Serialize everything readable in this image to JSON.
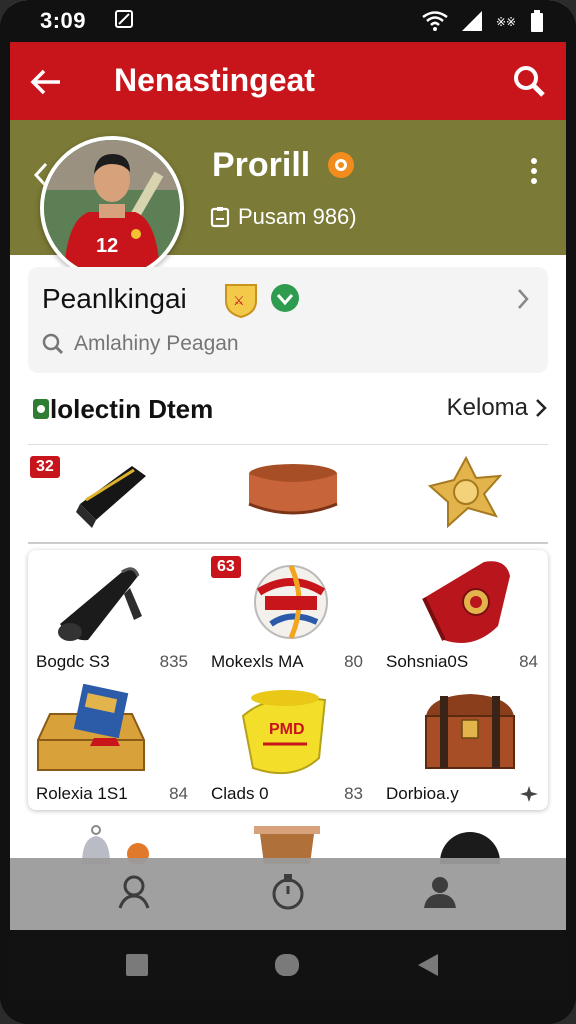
{
  "status_bar": {
    "time": "3:09"
  },
  "app_bar": {
    "title": "Nenastingeat"
  },
  "profile": {
    "name": "Prorill",
    "subtitle": "Pusam 986)",
    "jersey_number": "12"
  },
  "search_card": {
    "title": "Peanlkingai",
    "placeholder": "Amlahiny Peagan"
  },
  "section": {
    "title": "lolectin Dtem",
    "see_all": "Keloma"
  },
  "top_row": {
    "badge": "32"
  },
  "grid": {
    "items": [
      {
        "name": "Bogdc S3",
        "price": "835",
        "badge": ""
      },
      {
        "name": "Mokexls MA",
        "price": "80",
        "badge": "63"
      },
      {
        "name": "Sohsnia0S",
        "price": "84",
        "badge": ""
      },
      {
        "name": "Rolexia 1S1",
        "price": "84",
        "badge": ""
      },
      {
        "name": "Clads 0",
        "price": "83",
        "badge": ""
      },
      {
        "name": "Dorbioa.y",
        "price": "",
        "badge": ""
      }
    ],
    "sticker_text": "PMD"
  },
  "colors": {
    "app_bar": "#c8151b",
    "profile_header": "#7b7a36",
    "bottom_nav": "#9b9b9b"
  }
}
